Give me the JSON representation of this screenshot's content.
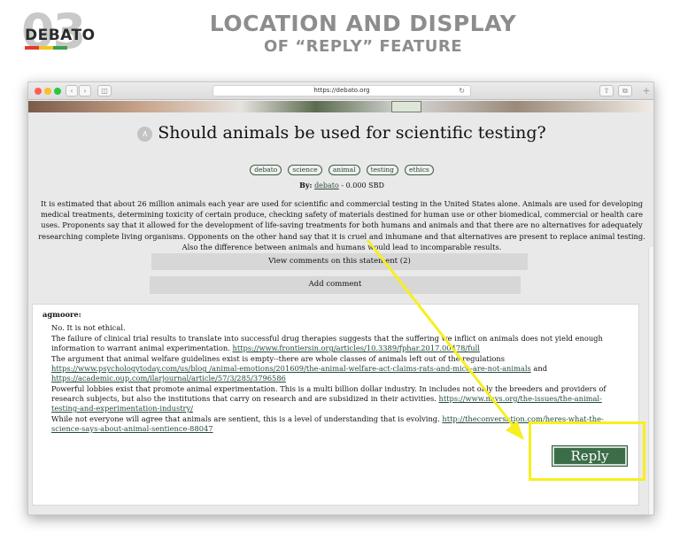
{
  "header": {
    "logo_number": "03",
    "logo_text": "DEBATO",
    "logo_colors": [
      "#e43b2f",
      "#f5c61c",
      "#3aa150"
    ],
    "title": "LOCATION AND DISPLAY",
    "subtitle": "OF “REPLY” FEATURE"
  },
  "browser": {
    "url": "https://debato.org",
    "traffic_lights": [
      "#fc5f57",
      "#fdbc2e",
      "#28c840"
    ],
    "reload_icon": "↻",
    "plus": "+"
  },
  "post": {
    "title": "Should animals be used for scientific testing?",
    "upvote_icon": "∧",
    "tags": [
      "debato",
      "science",
      "animal",
      "testing",
      "ethics"
    ],
    "by_label": "By:",
    "author": "debato",
    "amount": "- 0.000 SBD",
    "description": "It is estimated that about 26 million animals each year are used for scientific and commercial testing in the United States alone. Animals are used for developing medical treatments, determining toxicity of certain produce, checking safety of materials destined for human use or other biomedical, commercial or health care uses. Proponents say that it allowed for the development of life-saving treatments for both humans and animals and that there are no alternatives for adequately researching complete living organisms. Opponents on the other hand say that it is cruel and inhumane and that alternatives are present to replace animal testing. Also the difference between animals and humans would lead to incomparable results."
  },
  "buttons": {
    "view_comments": "View comments on this statement (2)",
    "add_comment": "Add comment",
    "reply": "Reply"
  },
  "comment": {
    "author": "agmoore:",
    "p1": "No. It is not ethical.",
    "p2_text": "The failure of clinical trial results to translate into successful drug therapies suggests that the suffering we inflict on animals does not yield enough information to warrant animal experimentation. ",
    "p2_link": "https://www.frontiersin.org/articles/10.3389/fphar.2017.00478/full",
    "p3_text": "The argument that animal welfare guidelines exist is empty--there are whole classes of animals left out of the regulations ",
    "p3_link1": "https://www.psychologytoday.com/us/blog /animal-emotions/201609/the-animal-welfare-act-claims-rats-and-mice-are-not-animals",
    "p3_and": " and ",
    "p3_link2": "https://academic.oup.com/ilarjournal/article/57/3/285/3796586",
    "p4_text": "Powerful lobbies exist that promote animal experimentation. This is a multi billion dollar industry. In includes not only the breeders and providers of research subjects, but also the institutions that carry on research and are subsidized in their activities. ",
    "p4_link": "https://www.navs.org/the-issues/the-animal-testing-and-experimentation-industry/",
    "p5_text": "While not everyone will agree that animals are sentient, this is a level of understanding that is evolving. ",
    "p5_link": "http://theconversation.com/heres-what-the-science-says-about-animal-sentience-88047"
  },
  "annotation_color": "#f7ef1f"
}
